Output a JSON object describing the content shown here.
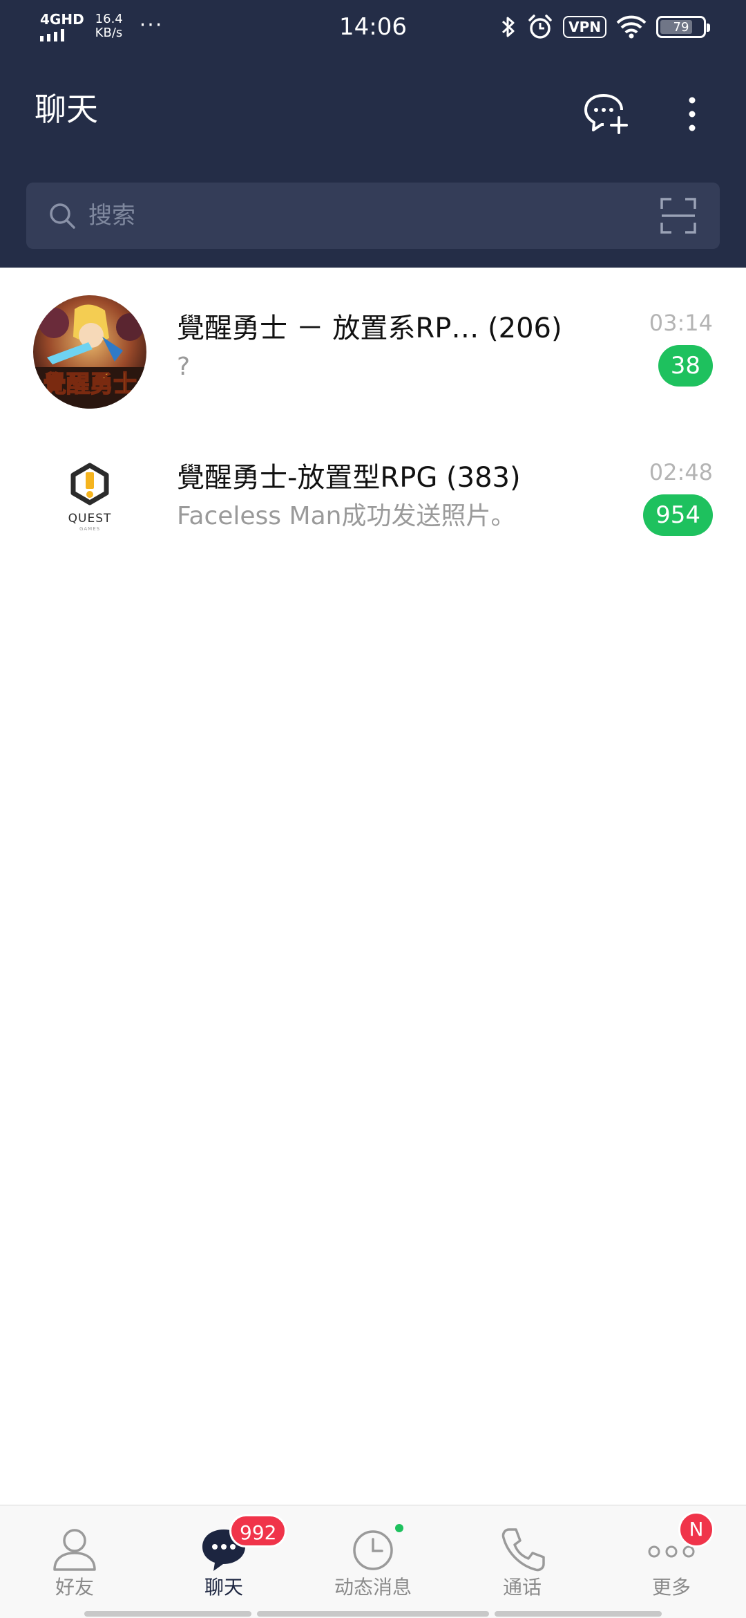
{
  "status_bar": {
    "network": "4GHD",
    "speed_value": "16.4",
    "speed_unit": "KB/s",
    "more": "···",
    "time": "14:06",
    "vpn": "VPN",
    "battery": "79",
    "battery_level": 0.79,
    "icons": [
      "bluetooth-icon",
      "alarm-icon",
      "vpn-icon",
      "wifi-icon",
      "battery-icon"
    ]
  },
  "header": {
    "title": "聊天",
    "icons": [
      "new-chat-icon",
      "more-vert-icon"
    ]
  },
  "search": {
    "placeholder": "搜索",
    "icons": [
      "search-icon",
      "scan-icon"
    ]
  },
  "chats": [
    {
      "name": "覺醒勇士 － 放置系RP…  (206)",
      "preview": "?",
      "time": "03:14",
      "unread": "38",
      "avatar_text": "覺醒勇士"
    },
    {
      "name": "覺醒勇士-放置型RPG (383)",
      "preview": "Faceless  Man成功发送照片。",
      "time": "02:48",
      "unread": "954",
      "avatar_text": "QUEST",
      "avatar_subtext": "GAMES"
    }
  ],
  "bottom_nav": {
    "items": [
      {
        "label": "好友",
        "icon": "friends-icon"
      },
      {
        "label": "聊天",
        "icon": "chat-icon",
        "badge": "992"
      },
      {
        "label": "动态消息",
        "icon": "timeline-icon"
      },
      {
        "label": "通话",
        "icon": "phone-icon"
      },
      {
        "label": "更多",
        "icon": "more-icon",
        "badge": "N"
      }
    ],
    "active_index": 1
  },
  "colors": {
    "header_bg": "#242d47",
    "search_bg": "#343d58",
    "unread_green": "#1ec15e",
    "badge_red": "#f0344a"
  }
}
